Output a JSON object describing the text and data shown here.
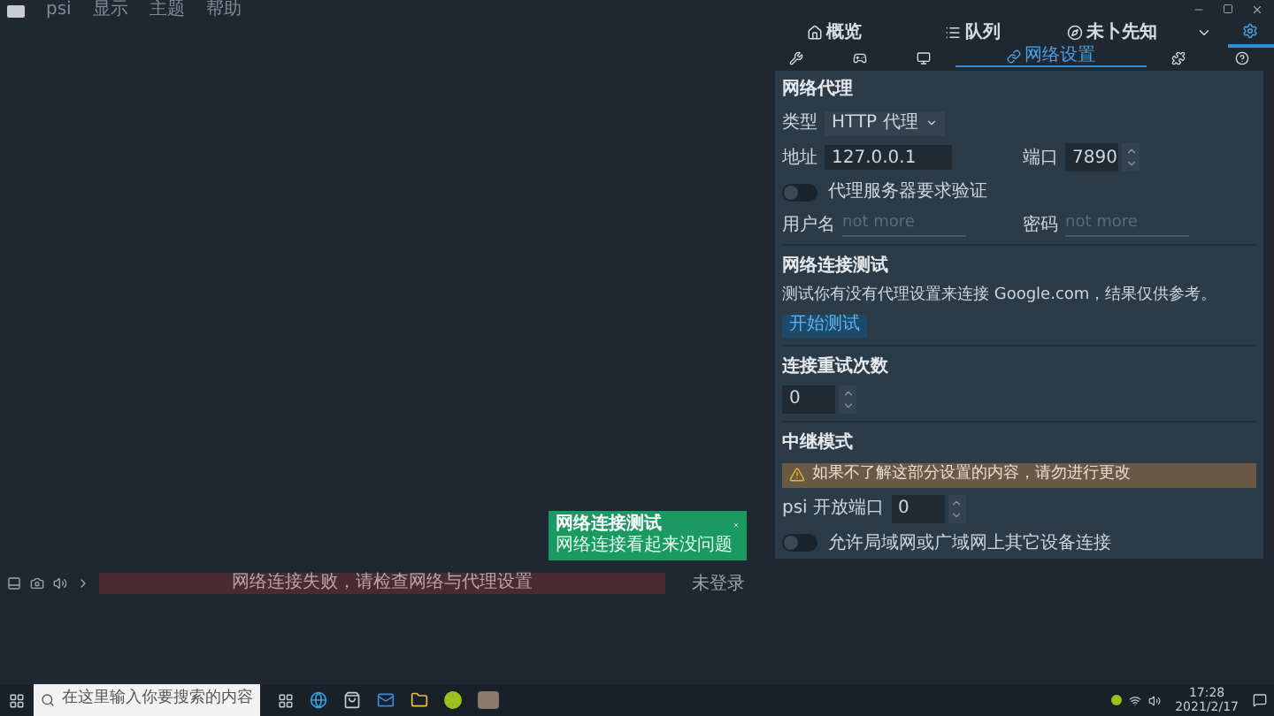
{
  "menu": [
    "psi",
    "显示",
    "主题",
    "帮助"
  ],
  "nav_tabs": [
    {
      "label": "概览",
      "selected": false
    },
    {
      "label": "队列",
      "selected": false
    },
    {
      "label": "未卜先知",
      "selected": false
    },
    {
      "selected": false
    },
    {
      "selected": true
    }
  ],
  "sub_tabs": [
    {
      "selected": false
    },
    {
      "selected": false
    },
    {
      "selected": false
    },
    {
      "label": "网络设置",
      "selected": true
    },
    {
      "selected": false
    },
    {
      "selected": false
    }
  ],
  "proxy": {
    "heading": "网络代理",
    "type_label": "类型",
    "type_value": "HTTP 代理",
    "address_label": "地址",
    "address_value": "127.0.0.1",
    "port_label": "端口",
    "port_value": "7890",
    "auth_toggle": {
      "label": "代理服务器要求验证",
      "on": false
    },
    "username_label": "用户名",
    "username_placeholder": "not more",
    "password_label": "密码",
    "password_placeholder": "not more"
  },
  "test": {
    "heading": "网络连接测试",
    "description": "测试你有没有代理设置来连接 Google.com，结果仅供参考。",
    "button": "开始测试"
  },
  "retry": {
    "heading": "连接重试次数",
    "value": "0"
  },
  "relay": {
    "heading": "中继模式",
    "warning": "如果不了解这部分设置的内容，请勿进行更改",
    "port_label": "psi 开放端口",
    "port_value": "0",
    "lan_toggle": {
      "label": "允许局域网或广域网上其它设备连接",
      "on": false
    }
  },
  "toast": {
    "title": "网络连接测试",
    "message": "网络连接看起来没问题"
  },
  "status_bar": {
    "message": "网络连接失败，请检查网络与代理设置",
    "login": "未登录"
  },
  "taskbar": {
    "search_placeholder": "在这里输入你要搜索的内容",
    "time": "17:28",
    "date": "2021/2/17"
  }
}
